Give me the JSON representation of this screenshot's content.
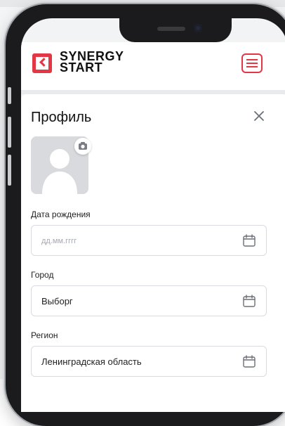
{
  "header": {
    "logo_line1": "SYNERGY",
    "logo_line2": "START"
  },
  "profile": {
    "title": "Профиль",
    "fields": [
      {
        "label": "Дата рождения",
        "value": "",
        "placeholder": "дд.мм.гггг"
      },
      {
        "label": "Город",
        "value": "Выборг",
        "placeholder": ""
      },
      {
        "label": "Регион",
        "value": "Ленинградская область",
        "placeholder": ""
      }
    ]
  },
  "icons": {
    "close": "close-icon",
    "calendar": "calendar-icon",
    "camera": "camera-icon",
    "menu": "hamburger-menu-icon",
    "avatar": "user-silhouette-icon"
  },
  "colors": {
    "brand": "#e23744",
    "text": "#111111",
    "border": "#d9dbe0",
    "placeholder": "#a7aab1"
  }
}
